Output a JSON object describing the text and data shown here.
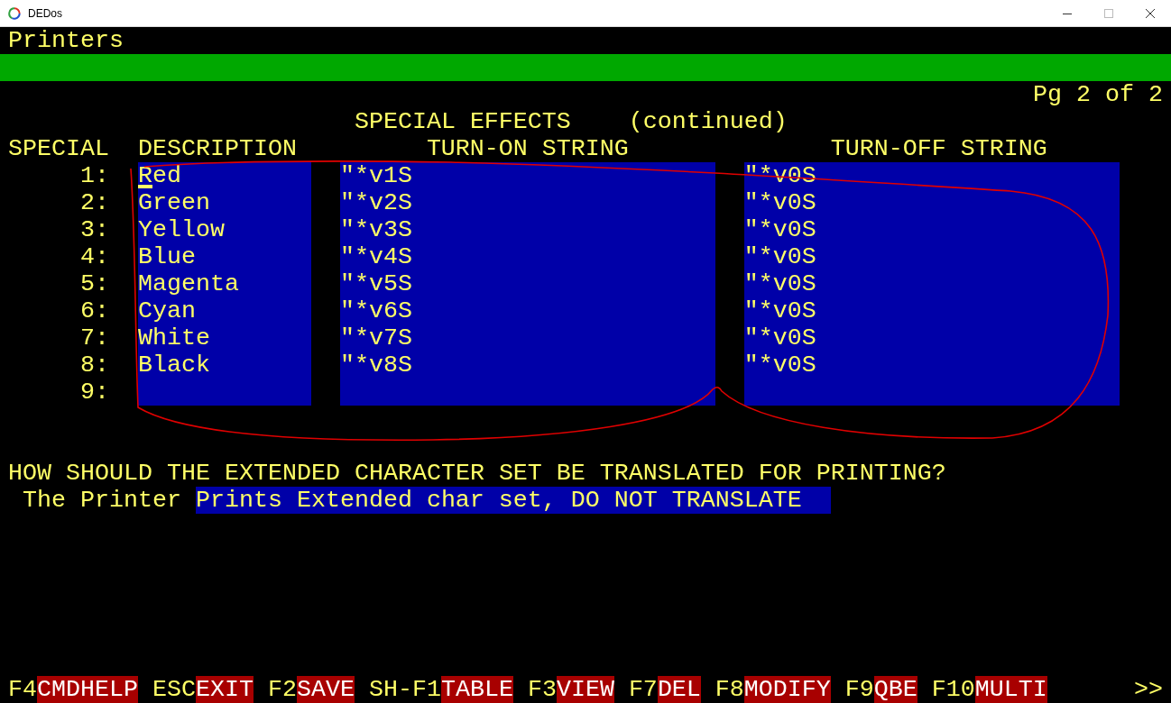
{
  "window": {
    "title": "DEDos"
  },
  "screen_title": "Printers",
  "page_indicator": "Pg 2 of 2",
  "section_title": {
    "title": "SPECIAL EFFECTS",
    "note": "(continued)"
  },
  "columns": [
    "SPECIAL",
    "DESCRIPTION",
    "TURN-ON STRING",
    "TURN-OFF STRING"
  ],
  "rows": [
    {
      "number": "1:",
      "description": "Red",
      "turn_on": "\"*v1S",
      "turn_off": "\"*v0S",
      "cursor": true
    },
    {
      "number": "2:",
      "description": "Green",
      "turn_on": "\"*v2S",
      "turn_off": "\"*v0S",
      "cursor": false
    },
    {
      "number": "3:",
      "description": "Yellow",
      "turn_on": "\"*v3S",
      "turn_off": "\"*v0S",
      "cursor": false
    },
    {
      "number": "4:",
      "description": "Blue",
      "turn_on": "\"*v4S",
      "turn_off": "\"*v0S",
      "cursor": false
    },
    {
      "number": "5:",
      "description": "Magenta",
      "turn_on": "\"*v5S",
      "turn_off": "\"*v0S",
      "cursor": false
    },
    {
      "number": "6:",
      "description": "Cyan",
      "turn_on": "\"*v6S",
      "turn_off": "\"*v0S",
      "cursor": false
    },
    {
      "number": "7:",
      "description": "White",
      "turn_on": "\"*v7S",
      "turn_off": "\"*v0S",
      "cursor": false
    },
    {
      "number": "8:",
      "description": "Black",
      "turn_on": "\"*v8S",
      "turn_off": "\"*v0S",
      "cursor": false
    },
    {
      "number": "9:",
      "cursor": false
    }
  ],
  "question": "HOW SHOULD THE EXTENDED CHARACTER SET BE TRANSLATED FOR PRINTING?",
  "answer": {
    "label": "The Printer",
    "value": "Prints Extended char set, DO NOT TRANSLATE"
  },
  "function_keys": [
    {
      "key": "F4",
      "label": "CMDHELP"
    },
    {
      "key": "ESC",
      "label": "EXIT"
    },
    {
      "key": "F2",
      "label": "SAVE"
    },
    {
      "key": "SH-F1",
      "label": "TABLE"
    },
    {
      "key": "F3",
      "label": "VIEW"
    },
    {
      "key": "F7",
      "label": "DEL"
    },
    {
      "key": "F8",
      "label": "MODIFY"
    },
    {
      "key": "F9",
      "label": "QBE"
    },
    {
      "key": "F10",
      "label": "MULTI"
    }
  ],
  "more": ">>"
}
